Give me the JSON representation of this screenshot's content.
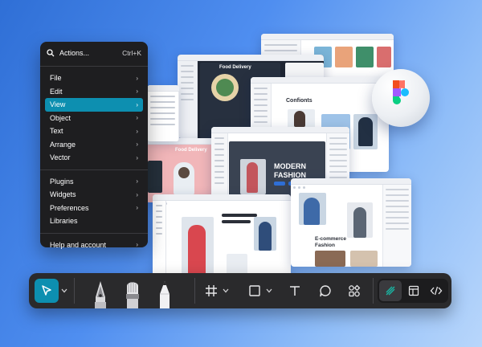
{
  "menu": {
    "search_label": "Actions...",
    "shortcut": "Ctrl+K",
    "group1": [
      {
        "label": "File",
        "active": false
      },
      {
        "label": "Edit",
        "active": false
      },
      {
        "label": "View",
        "active": true
      },
      {
        "label": "Object",
        "active": false
      },
      {
        "label": "Text",
        "active": false
      },
      {
        "label": "Arrange",
        "active": false
      },
      {
        "label": "Vector",
        "active": false
      }
    ],
    "group2": [
      {
        "label": "Plugins"
      },
      {
        "label": "Widgets"
      },
      {
        "label": "Preferences"
      },
      {
        "label": "Libraries"
      }
    ],
    "group3": [
      {
        "label": "Help and account"
      }
    ],
    "chevron": "›",
    "active_color": "#0d8fb0"
  },
  "collage": {
    "food_delivery": "Food Delivery",
    "food_delivery_2": "Food Delivery",
    "confionts": "Confionts",
    "modern_fashion": "MODERN FASHION",
    "ecommerce_fashion": "E-commerce Fashion"
  },
  "toolbar": {
    "tools": [
      {
        "name": "move-tool",
        "icon": "cursor-arrow-icon",
        "selected": true
      },
      {
        "name": "pen-tool",
        "icon": "fountain-pen-icon"
      },
      {
        "name": "brush-tool",
        "icon": "brush-icon"
      },
      {
        "name": "pencil-tool",
        "icon": "pencil-icon"
      },
      {
        "name": "frame-tool",
        "icon": "hash-frame-icon"
      },
      {
        "name": "shape-tool",
        "icon": "square-icon"
      },
      {
        "name": "text-tool",
        "icon": "text-t-icon"
      },
      {
        "name": "comment-tool",
        "icon": "speech-bubble-icon"
      },
      {
        "name": "components-tool",
        "icon": "components-icon"
      },
      {
        "name": "design-mode",
        "icon": "design-icon",
        "selected": true
      },
      {
        "name": "prototype-mode",
        "icon": "layout-icon"
      },
      {
        "name": "dev-mode",
        "icon": "code-brackets-icon"
      }
    ],
    "accent": "#0d8fb0"
  }
}
